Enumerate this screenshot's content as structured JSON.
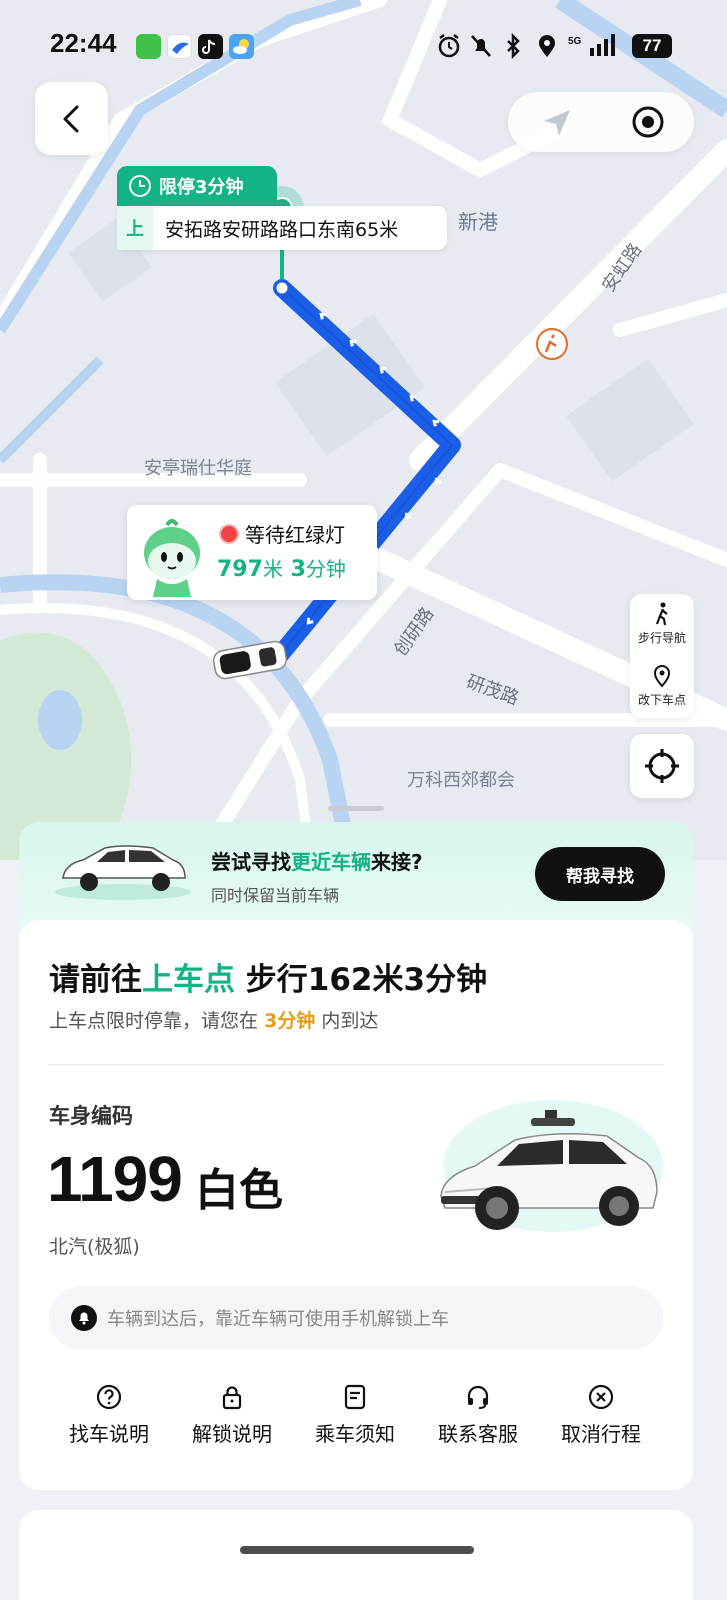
{
  "status_bar": {
    "time": "22:44",
    "battery": "77",
    "app_icons": [
      "messages-icon",
      "bird-app-icon",
      "tiktok-icon",
      "weather-icon"
    ],
    "status_icons": [
      "alarm-icon",
      "mute-icon",
      "bluetooth-icon",
      "location-icon",
      "5g-signal-icon"
    ]
  },
  "map": {
    "pickup_tag": "限停3分钟",
    "pickup_marker": "上",
    "pickup_address": "安拓路安研路路口东南65米",
    "labels": {
      "poi_1": "安亭瑞仕华庭",
      "poi_2": "万科西郊都会",
      "poi_3": "新港",
      "road_1": "创研路",
      "road_2": "研茂路",
      "road_3": "安虹路"
    },
    "status_card": {
      "title": "等待红绿灯",
      "distance": "797",
      "distance_unit": "米",
      "duration": "3",
      "duration_unit": "分钟"
    },
    "tools": {
      "walk_nav": "步行导航",
      "change_dropoff": "改下车点"
    },
    "route_color": "#1a5ee8",
    "accent_color": "#14b386"
  },
  "promo": {
    "question_prefix": "尝试寻找",
    "question_highlight": "更近车辆",
    "question_suffix": "来接?",
    "subtitle": "同时保留当前车辆",
    "button": "帮我寻找"
  },
  "trip": {
    "headline_prefix": "请前往",
    "headline_highlight": "上车点",
    "headline_suffix": "步行162米3分钟",
    "subline_prefix": "上车点限时停靠，请您在",
    "subline_highlight": "3分钟",
    "subline_suffix": "内到达",
    "code_label": "车身编码",
    "code_number": "1199",
    "car_color": "白色",
    "car_brand": "北汽(极狐)",
    "notice": "车辆到达后，靠近车辆可使用手机解锁上车",
    "actions": [
      {
        "label": "找车说明",
        "icon": "question-icon"
      },
      {
        "label": "解锁说明",
        "icon": "lock-icon"
      },
      {
        "label": "乘车须知",
        "icon": "document-icon"
      },
      {
        "label": "联系客服",
        "icon": "headset-icon"
      },
      {
        "label": "取消行程",
        "icon": "cancel-icon"
      }
    ]
  },
  "colors": {
    "accent": "#14b386",
    "warning": "#e89b17",
    "route": "#1a5ee8"
  }
}
